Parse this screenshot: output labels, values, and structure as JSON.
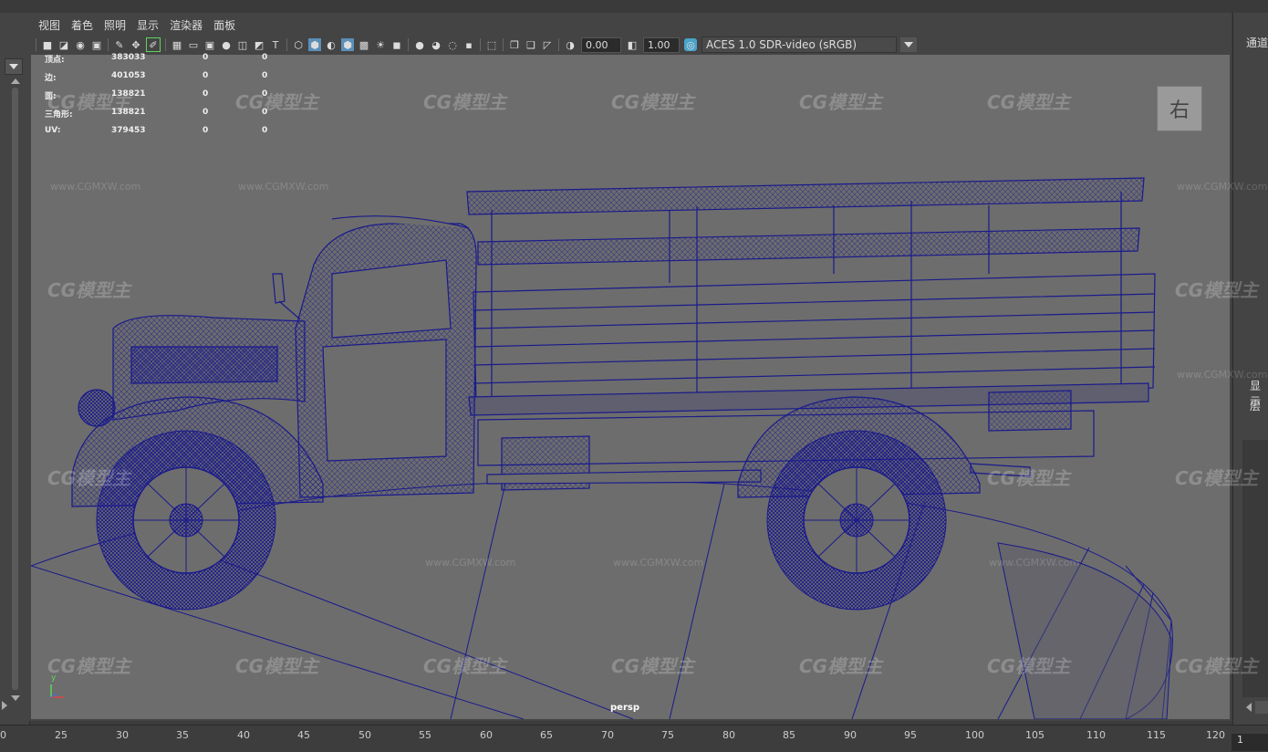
{
  "menu": [
    "视图",
    "着色",
    "照明",
    "显示",
    "渲染器",
    "面板"
  ],
  "toolbar": {
    "exposure_value": "0.00",
    "gamma_value": "1.00",
    "color_space": "ACES 1.0 SDR-video (sRGB)"
  },
  "hud": {
    "rows": [
      {
        "label": "顶点:",
        "value": "383033",
        "c2": "0",
        "c3": "0"
      },
      {
        "label": "边:",
        "value": "401053",
        "c2": "0",
        "c3": "0"
      },
      {
        "label": "面:",
        "value": "138821",
        "c2": "0",
        "c3": "0"
      },
      {
        "label": "三角形:",
        "value": "138821",
        "c2": "0",
        "c3": "0"
      },
      {
        "label": "UV:",
        "value": "379453",
        "c2": "0",
        "c3": "0"
      }
    ]
  },
  "viewcube_label": "右",
  "camera_name": "persp",
  "axis_label": "y",
  "right_panel": {
    "channels": "通道",
    "display": "显示",
    "layers": "层"
  },
  "timeline": {
    "ticks": [
      "0",
      "25",
      "30",
      "35",
      "40",
      "45",
      "50",
      "55",
      "60",
      "65",
      "70",
      "75",
      "80",
      "85",
      "90",
      "95",
      "100",
      "105",
      "110",
      "115",
      "120"
    ],
    "current_frame": "1"
  },
  "watermark": {
    "logo": "CG模型主",
    "url": "www.CGMXW.com"
  },
  "colors": {
    "viewport_bg": "#6d6d6d",
    "wire": "#1a1a8c",
    "ui_bg": "#444444",
    "highlight": "#5a8fb8"
  }
}
